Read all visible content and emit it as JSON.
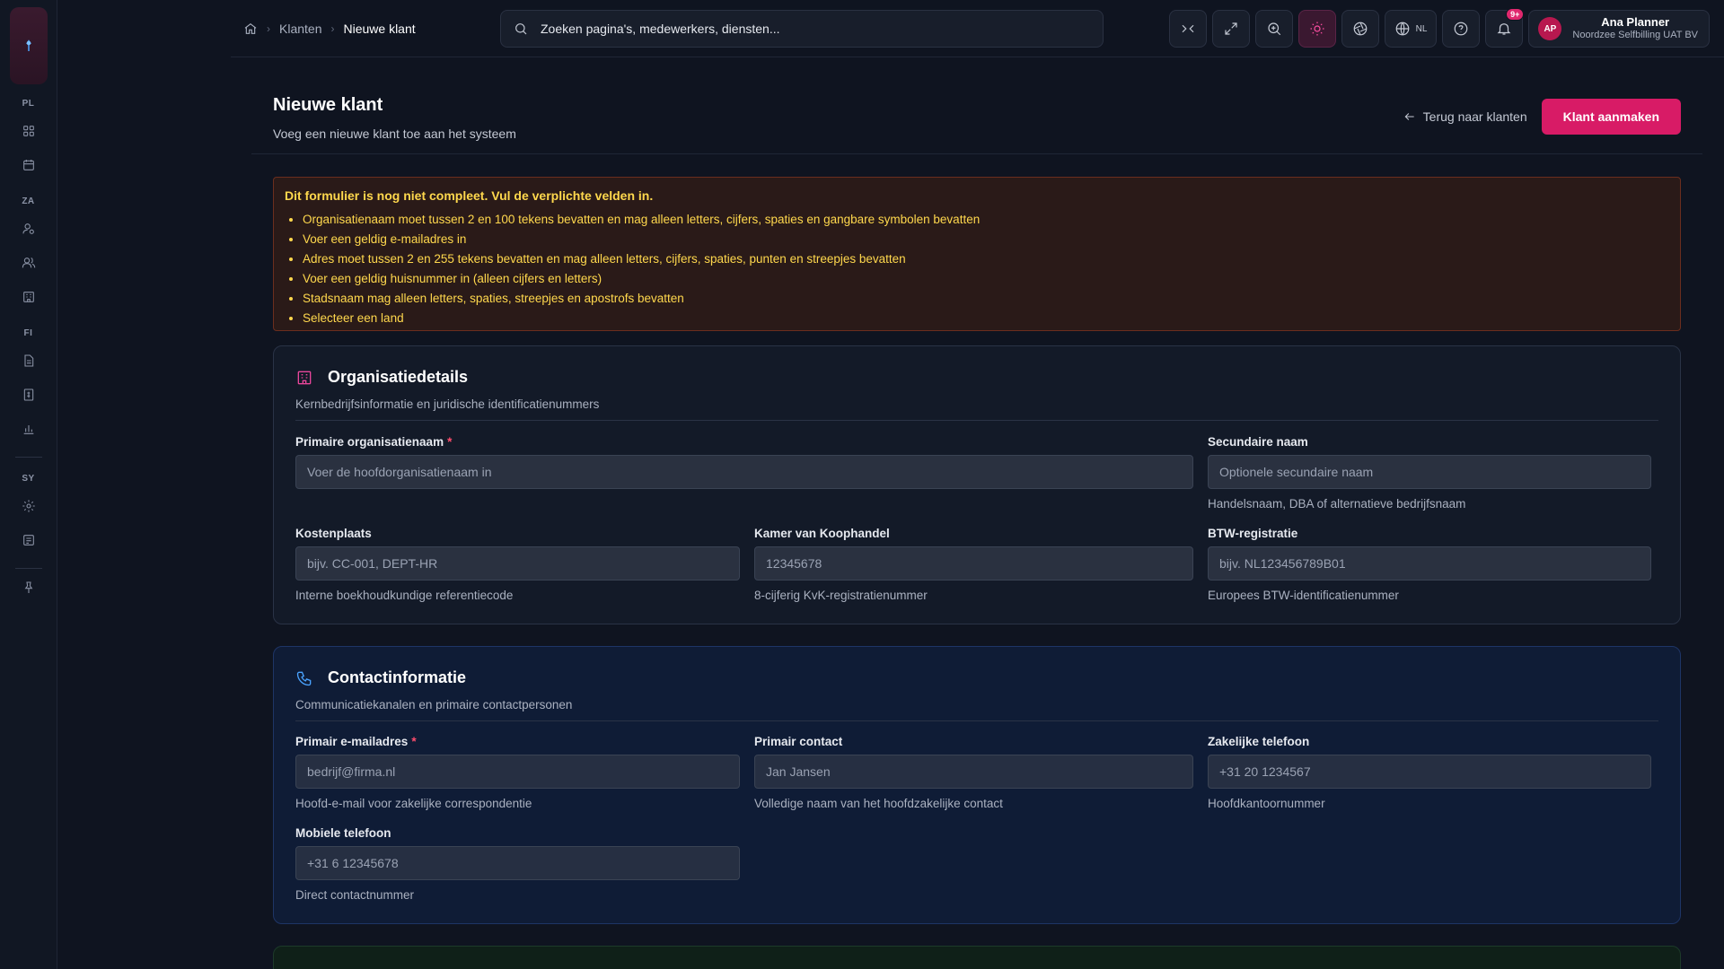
{
  "sidebar": {
    "groups": [
      {
        "label": "PL"
      },
      {
        "label": "ZA"
      },
      {
        "label": "FI"
      },
      {
        "label": "SY"
      }
    ]
  },
  "breadcrumb": {
    "items": [
      "Klanten",
      "Nieuwe klant"
    ]
  },
  "search": {
    "placeholder": "Zoeken pagina's, medewerkers, diensten..."
  },
  "topbar": {
    "lang": "NL",
    "notifications_badge": "9+"
  },
  "user": {
    "initials": "AP",
    "name": "Ana Planner",
    "org": "Noordzee Selfbilling UAT BV"
  },
  "page": {
    "title": "Nieuwe klant",
    "subtitle": "Voeg een nieuwe klant toe aan het systeem",
    "back_label": "Terug naar klanten",
    "create_label": "Klant aanmaken"
  },
  "alert": {
    "title": "Dit formulier is nog niet compleet. Vul de verplichte velden in.",
    "items": [
      "Organisatienaam moet tussen 2 en 100 tekens bevatten en mag alleen letters, cijfers, spaties en gangbare symbolen bevatten",
      "Voer een geldig e-mailadres in",
      "Adres moet tussen 2 en 255 tekens bevatten en mag alleen letters, cijfers, spaties, punten en streepjes bevatten",
      "Voer een geldig huisnummer in (alleen cijfers en letters)",
      "Stadsnaam mag alleen letters, spaties, streepjes en apostrofs bevatten",
      "Selecteer een land"
    ]
  },
  "org": {
    "title": "Organisatiedetails",
    "subtitle": "Kernbedrijfsinformatie en juridische identificatienummers",
    "primary_name": {
      "label": "Primaire organisatienaam",
      "placeholder": "Voer de hoofdorganisatienaam in"
    },
    "secondary_name": {
      "label": "Secundaire naam",
      "placeholder": "Optionele secundaire naam",
      "help": "Handelsnaam, DBA of alternatieve bedrijfsnaam"
    },
    "cost_center": {
      "label": "Kostenplaats",
      "placeholder": "bijv. CC-001, DEPT-HR",
      "help": "Interne boekhoudkundige referentiecode"
    },
    "kvk": {
      "label": "Kamer van Koophandel",
      "placeholder": "12345678",
      "help": "8-cijferig KvK-registratienummer"
    },
    "vat": {
      "label": "BTW-registratie",
      "placeholder": "bijv. NL123456789B01",
      "help": "Europees BTW-identificatienummer"
    }
  },
  "contact": {
    "title": "Contactinformatie",
    "subtitle": "Communicatiekanalen en primaire contactpersonen",
    "email": {
      "label": "Primair e-mailadres",
      "placeholder": "bedrijf@firma.nl",
      "help": "Hoofd-e-mail voor zakelijke correspondentie"
    },
    "contact": {
      "label": "Primair contact",
      "placeholder": "Jan Jansen",
      "help": "Volledige naam van het hoofdzakelijke contact"
    },
    "business_phone": {
      "label": "Zakelijke telefoon",
      "placeholder": "+31 20 1234567",
      "help": "Hoofdkantoornummer"
    },
    "mobile": {
      "label": "Mobiele telefoon",
      "placeholder": "+31 6 12345678",
      "help": "Direct contactnummer"
    }
  },
  "colors": {
    "accent": "#d81b66",
    "warning_text": "#ffd84d",
    "background": "#0f1420"
  }
}
